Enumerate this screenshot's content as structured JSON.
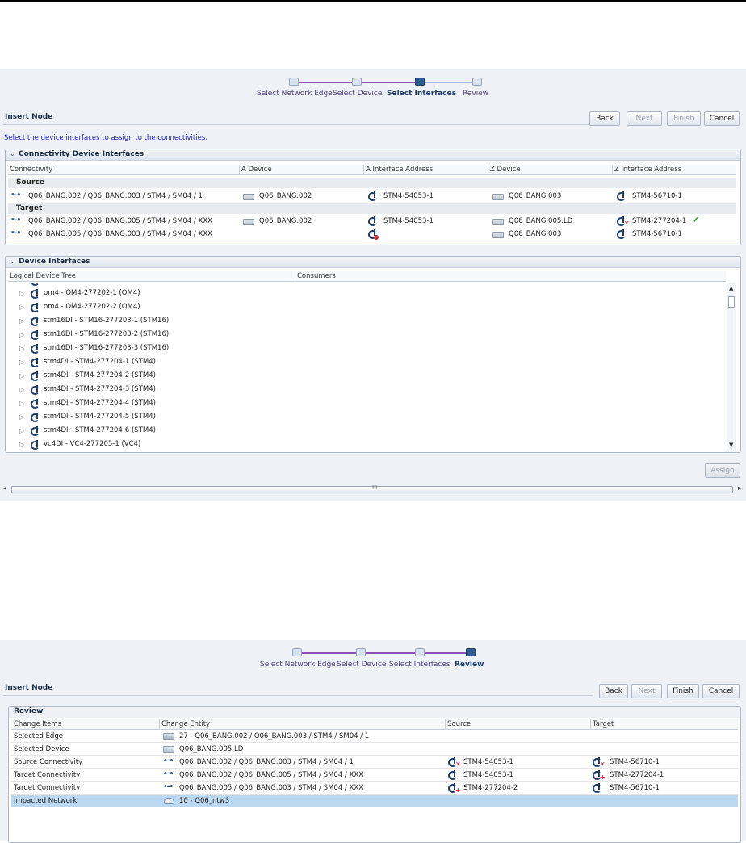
{
  "train": {
    "steps": [
      "Select Network Edge",
      "Select Device",
      "Select Interfaces",
      "Review"
    ]
  },
  "screen1": {
    "title": "Insert Node",
    "buttons": {
      "back": "Back",
      "next": "Next",
      "finish": "Finish",
      "cancel": "Cancel",
      "assign": "Assign"
    },
    "instruction": "Select the device interfaces to assign to the connectivities.",
    "connectivity_panel": {
      "title": "Connectivity Device Interfaces",
      "columns": [
        "Connectivity",
        "A Device",
        "A Interface Address",
        "Z Device",
        "Z Interface Address"
      ],
      "groups": {
        "source": "Source",
        "target": "Target"
      },
      "source_row": {
        "connectivity": "Q06_BANG.002 / Q06_BANG.003 / STM4 / SM04 / 1",
        "a_device": "Q06_BANG.002",
        "a_interface": "STM4-54053-1",
        "z_device": "Q06_BANG.003",
        "z_interface": "STM4-56710-1"
      },
      "target_rows": [
        {
          "connectivity": "Q06_BANG.002 / Q06_BANG.005 / STM4 / SM04 / XXX",
          "a_device": "Q06_BANG.002",
          "a_interface": "STM4-54053-1",
          "z_device": "Q06_BANG.005.LD",
          "z_interface": "STM4-277204-1"
        },
        {
          "connectivity": "Q06_BANG.005 / Q06_BANG.003 / STM4 / SM04 / XXX",
          "a_device": "",
          "a_interface": "",
          "z_device": "Q06_BANG.003",
          "z_interface": "STM4-56710-1"
        }
      ]
    },
    "device_panel": {
      "title": "Device Interfaces",
      "columns": [
        "Logical Device Tree",
        "Consumers"
      ],
      "tree": [
        "om4 - OM4-277202-1 (OM4)",
        "om4 - OM4-277202-2 (OM4)",
        "stm16DI - STM16-277203-1 (STM16)",
        "stm16DI - STM16-277203-2 (STM16)",
        "stm16DI - STM16-277203-3 (STM16)",
        "stm4DI - STM4-277204-1 (STM4)",
        "stm4DI - STM4-277204-2 (STM4)",
        "stm4DI - STM4-277204-3 (STM4)",
        "stm4DI - STM4-277204-4 (STM4)",
        "stm4DI - STM4-277204-5 (STM4)",
        "stm4DI - STM4-277204-6 (STM4)",
        "vc4DI - VC4-277205-1 (VC4)"
      ]
    }
  },
  "screen2": {
    "title": "Insert Node",
    "buttons": {
      "back": "Back",
      "next": "Next",
      "finish": "Finish",
      "cancel": "Cancel"
    },
    "review_panel": {
      "title": "Review",
      "columns": [
        "Change Items",
        "Change Entity",
        "Source",
        "Target"
      ],
      "rows": [
        {
          "item": "Selected Edge",
          "entity": "27 - Q06_BANG.002 / Q06_BANG.003 / STM4 / SM04 / 1",
          "source": "",
          "target": ""
        },
        {
          "item": "Selected Device",
          "entity": "Q06_BANG.005.LD",
          "source": "",
          "target": ""
        },
        {
          "item": "Source Connectivity",
          "entity": "Q06_BANG.002 / Q06_BANG.003 / STM4 / SM04 / 1",
          "source": "STM4-54053-1",
          "target": "STM4-56710-1"
        },
        {
          "item": "Target Connectivity",
          "entity": "Q06_BANG.002 / Q06_BANG.005 / STM4 / SM04 / XXX",
          "source": "STM4-54053-1",
          "target": "STM4-277204-1"
        },
        {
          "item": "Target Connectivity",
          "entity": "Q06_BANG.005 / Q06_BANG.003 / STM4 / SM04 / XXX",
          "source": "STM4-277204-2",
          "target": "STM4-56710-1"
        },
        {
          "item": "Impacted Network",
          "entity": "10 - Q06_ntw3",
          "source": "",
          "target": ""
        }
      ]
    }
  },
  "colors": {
    "train_visited": "#8e4fb5",
    "train_current": "#2f5a92",
    "instruction": "#1a1ad8",
    "selected_row": "#bcd7f0",
    "check": "#2a9a2a",
    "error": "#d02020"
  }
}
